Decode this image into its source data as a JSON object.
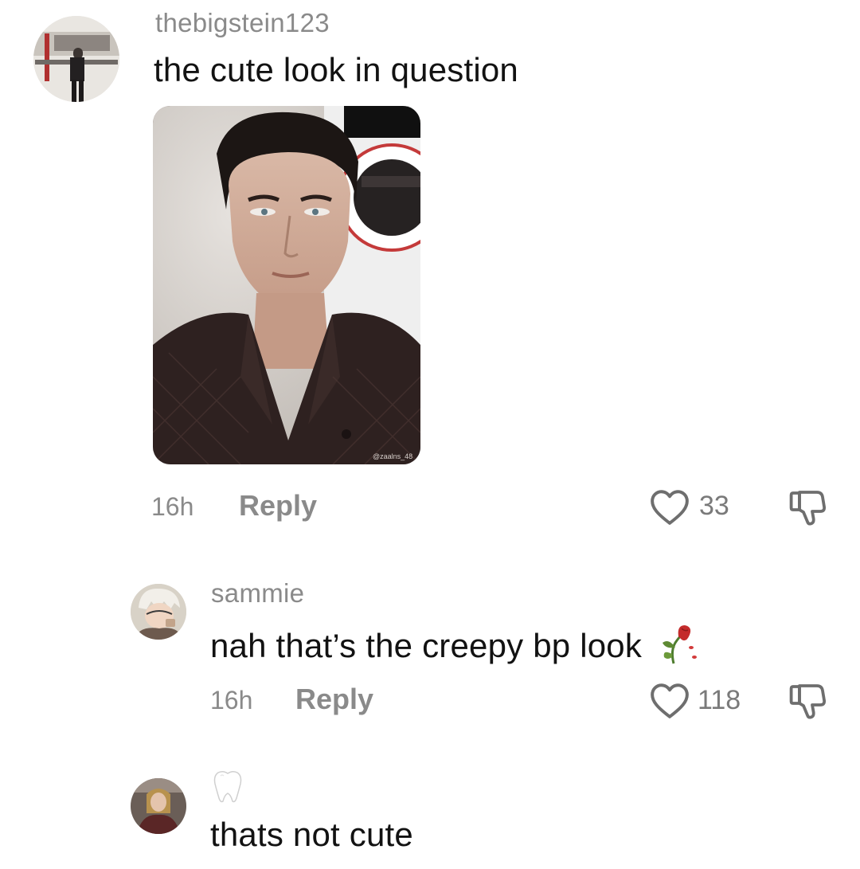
{
  "comments": [
    {
      "username": "thebigstein123",
      "text": "the cute look in question",
      "photo_watermark": "@zaalns_48",
      "time": "16h",
      "reply_label": "Reply",
      "likes": "33"
    },
    {
      "username": "sammie",
      "text": "nah that’s the creepy bp look",
      "emoji": "wilted-rose-emoji",
      "time": "16h",
      "reply_label": "Reply",
      "likes": "118"
    },
    {
      "username_emoji": "tooth-emoji",
      "text": "thats not cute"
    }
  ],
  "icons": {
    "like": "heart-outline-icon",
    "dislike": "thumbs-down-outline-icon"
  },
  "colors": {
    "meta_gray": "#8a8a8a",
    "text": "#121212",
    "background": "#ffffff"
  }
}
